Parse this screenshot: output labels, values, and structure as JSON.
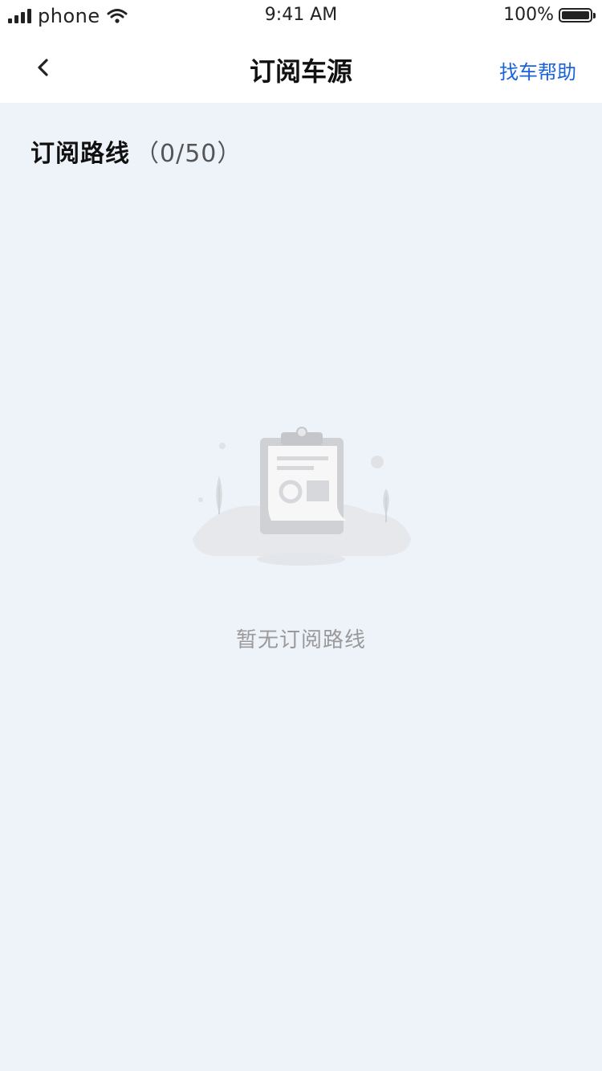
{
  "status_bar": {
    "carrier": "phone",
    "time": "9:41 AM",
    "battery": "100%",
    "battery_level": 1.0
  },
  "nav": {
    "back_icon": "chevron-left-icon",
    "title": "订阅车源",
    "help_label": "找车帮助"
  },
  "section": {
    "title": "订阅路线",
    "count": "（0/50）"
  },
  "empty_state": {
    "icon": "empty-clipboard-icon",
    "message": "暂无订阅路线"
  },
  "colors": {
    "background": "#eef3fa",
    "accent": "#1b63d8",
    "muted_text": "#9a9a9a"
  }
}
